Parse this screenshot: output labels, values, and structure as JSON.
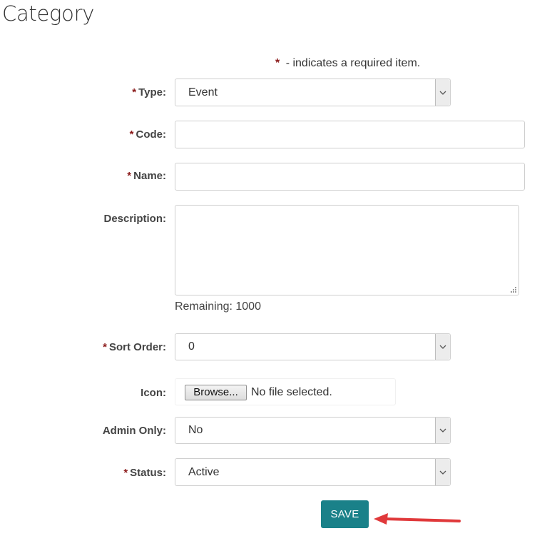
{
  "page": {
    "title": "Category"
  },
  "required_note": {
    "star": "*",
    "text": "- indicates a required item."
  },
  "form": {
    "type": {
      "label": "Type:",
      "required_mark": "*",
      "value": "Event"
    },
    "code": {
      "label": "Code:",
      "required_mark": "*",
      "value": ""
    },
    "name": {
      "label": "Name:",
      "required_mark": "*",
      "value": ""
    },
    "description": {
      "label": "Description:",
      "value": "",
      "remaining": "Remaining: 1000"
    },
    "sort_order": {
      "label": "Sort Order:",
      "required_mark": "*",
      "value": "0"
    },
    "icon": {
      "label": "Icon:",
      "browse_label": "Browse...",
      "file_status": "No file selected."
    },
    "admin_only": {
      "label": "Admin Only:",
      "value": "No"
    },
    "status": {
      "label": "Status:",
      "required_mark": "*",
      "value": "Active"
    }
  },
  "actions": {
    "save_label": "SAVE"
  },
  "colors": {
    "save_button": "#1a8189",
    "required_star": "#8b1a1a",
    "annotation_arrow": "#e0393b"
  },
  "icons": {
    "select_arrow": "chevron-down-icon",
    "resize_grip": "resize-grip-icon",
    "annotation": "arrow-left-icon"
  }
}
